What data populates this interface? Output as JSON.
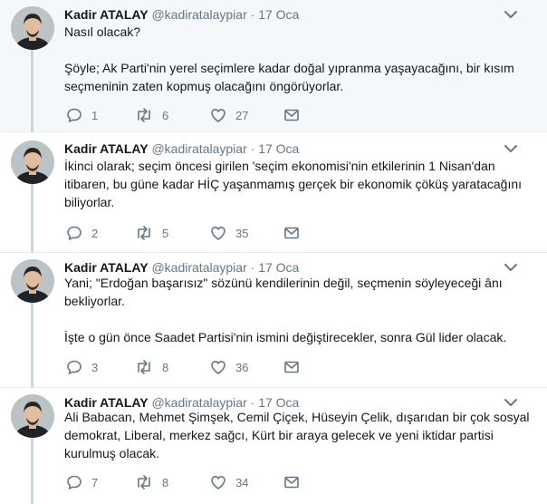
{
  "colors": {
    "highlight_background": "#f5f8fa",
    "secondary_text": "#657786",
    "thread_line": "#ccd6dd"
  },
  "icons": {
    "reply": "reply-icon",
    "retweet": "retweet-icon",
    "like": "heart-icon",
    "message": "envelope-icon",
    "menu": "chevron-down-icon"
  },
  "tweets": [
    {
      "name": "Kadir ATALAY",
      "handle": "@kadiratalaypiar",
      "separator": "·",
      "time": "17 Oca",
      "paragraphs": [
        "Nasıl olacak?",
        "Şöyle; Ak Parti'nin yerel seçimlere kadar doğal yıpranma yaşayacağını, bir kısım seçmeninin zaten kopmuş olacağını öngörüyorlar."
      ],
      "replies": "1",
      "retweets": "6",
      "likes": "27"
    },
    {
      "name": "Kadir ATALAY",
      "handle": "@kadiratalaypiar",
      "separator": "·",
      "time": "17 Oca",
      "paragraphs": [
        "İkinci olarak; seçim öncesi girilen 'seçim ekonomisi'nin etkilerinin 1 Nisan'dan itibaren, bu güne kadar HİÇ yaşanmamış gerçek bir ekonomik çöküş yaratacağını biliyorlar."
      ],
      "replies": "2",
      "retweets": "5",
      "likes": "35"
    },
    {
      "name": "Kadir ATALAY",
      "handle": "@kadiratalaypiar",
      "separator": "·",
      "time": "17 Oca",
      "paragraphs": [
        "Yani; \"Erdoğan başarısız\" sözünü kendilerinin değil, seçmenin söyleyeceği ânı bekliyorlar.",
        "İşte o gün önce Saadet Partisi'nin ismini değiştirecekler, sonra Gül lider olacak."
      ],
      "replies": "3",
      "retweets": "8",
      "likes": "36"
    },
    {
      "name": "Kadir ATALAY",
      "handle": "@kadiratalaypiar",
      "separator": "·",
      "time": "17 Oca",
      "paragraphs": [
        "Ali Babacan, Mehmet Şimşek, Cemil Çiçek, Hüseyin Çelik, dışarıdan bir çok sosyal demokrat, Liberal, merkez sağcı, Kürt bir araya gelecek ve yeni iktidar partisi kurulmuş olacak."
      ],
      "replies": "7",
      "retweets": "8",
      "likes": "34"
    }
  ]
}
